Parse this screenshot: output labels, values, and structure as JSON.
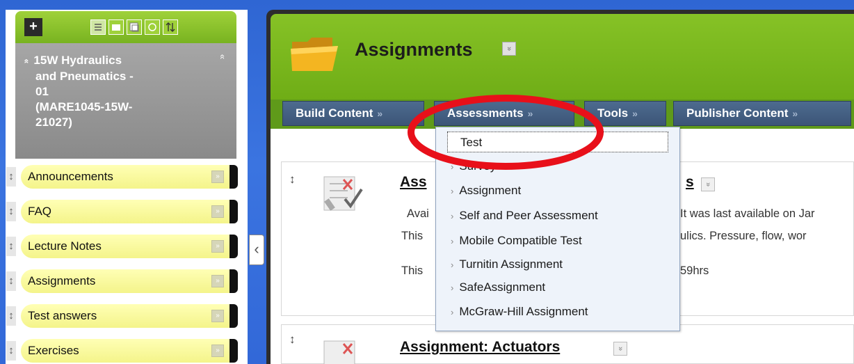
{
  "course": {
    "title_lines": [
      "15W Hydraulics",
      "and Pneumatics -",
      "01",
      "(MARE1045-15W-",
      "21027)"
    ],
    "expand_arrow": "«",
    "collapse_arrow": "«"
  },
  "left_toolbar": {
    "add_label": "+",
    "icons": [
      "list-view-icon",
      "folder-view-icon",
      "window-icon",
      "refresh-icon",
      "sort-icon"
    ]
  },
  "course_menu": {
    "items": [
      {
        "label": "Announcements"
      },
      {
        "label": "FAQ"
      },
      {
        "label": "Lecture Notes"
      },
      {
        "label": "Assignments"
      },
      {
        "label": "Test answers"
      },
      {
        "label": "Exercises"
      }
    ]
  },
  "page": {
    "title": "Assignments",
    "title_chevron": "»"
  },
  "action_bar": {
    "buttons": [
      {
        "label": "Build Content"
      },
      {
        "label": "Assessments"
      },
      {
        "label": "Tools"
      },
      {
        "label": "Publisher Content"
      }
    ],
    "chevron": "»"
  },
  "assessments_menu": {
    "items": [
      {
        "label": "Test"
      },
      {
        "label": "Survey"
      },
      {
        "label": "Assignment"
      },
      {
        "label": "Self and Peer Assessment"
      },
      {
        "label": "Mobile Compatible Test"
      },
      {
        "label": "Turnitin Assignment"
      },
      {
        "label": "SafeAssignment"
      },
      {
        "label": "McGraw-Hill Assignment"
      }
    ]
  },
  "content_items": [
    {
      "title_left": "Ass",
      "title_right": "s",
      "line1_left": "Avai",
      "line1_right": "It was last available on Jar",
      "line2_left": "This",
      "line2_right": "ulics. Pressure, flow, wor",
      "line3_left": "This",
      "line3_right": "59hrs"
    },
    {
      "title": "Assignment: Actuators"
    }
  ],
  "colors": {
    "header_green": "#7ab61f",
    "action_blue": "#46617f",
    "menu_yellow": "#f8f89c",
    "highlight_red": "#e8101a"
  }
}
